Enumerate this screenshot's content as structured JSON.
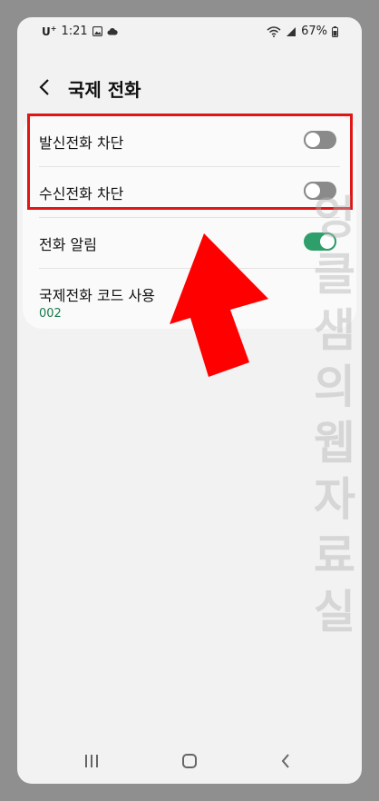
{
  "status_bar": {
    "carrier": "U",
    "carrier_sup": "+",
    "time": "1:21",
    "battery": "67%"
  },
  "header": {
    "title": "국제 전화"
  },
  "settings": [
    {
      "label": "발신전화 차단",
      "toggle": "off"
    },
    {
      "label": "수신전화 차단",
      "toggle": "off"
    },
    {
      "label": "전화 알림",
      "toggle": "on"
    },
    {
      "label": "국제전화 코드 사용",
      "value": "002"
    }
  ],
  "watermark": [
    "엉",
    "클",
    "샘",
    "의",
    "웹",
    "자",
    "료",
    "실"
  ],
  "colors": {
    "accent_green": "#2e9e6a",
    "highlight_red": "#e01515",
    "arrow_red": "#ff0000",
    "background": "#f2f2f2"
  },
  "nav": {
    "icons": [
      "recent-apps-icon",
      "home-icon",
      "back-icon"
    ]
  }
}
